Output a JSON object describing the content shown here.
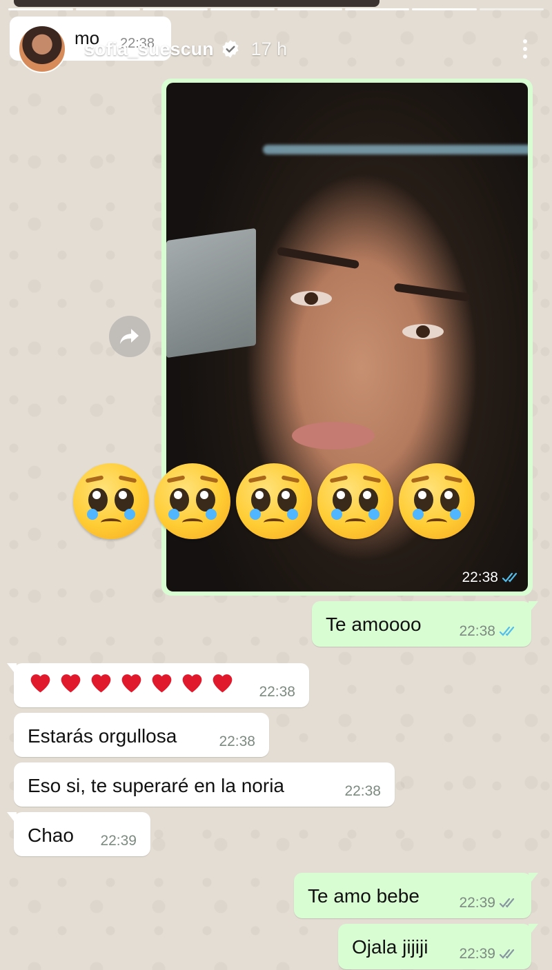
{
  "story": {
    "username": "sofia_suescun",
    "time_ago": "17 h",
    "progress_segments": 8,
    "progress_done": 7
  },
  "quoted": {
    "text": "mo",
    "time": "22:38"
  },
  "media_message": {
    "time": "22:38"
  },
  "emoji_row": {
    "emoji": "pleading-face",
    "count": 5
  },
  "messages": [
    {
      "text": "Te amoooo",
      "time": "22:38",
      "direction": "outgoing",
      "read": true
    },
    {
      "text": "",
      "time": "22:38",
      "direction": "incoming",
      "hearts": 7
    },
    {
      "text": "Estarás orgullosa",
      "time": "22:38",
      "direction": "incoming"
    },
    {
      "text": "Eso si, te superaré en la noria",
      "time": "22:38",
      "direction": "incoming"
    },
    {
      "text": "Chao",
      "time": "22:39",
      "direction": "incoming"
    },
    {
      "text": "Te amo bebe",
      "time": "22:39",
      "direction": "outgoing",
      "read": false
    },
    {
      "text": "Ojala jijiji",
      "time": "22:39",
      "direction": "outgoing",
      "read": false
    }
  ],
  "colors": {
    "outgoing_bubble": "#d9fdd3",
    "incoming_bubble": "#ffffff",
    "read_tick": "#53bdeb",
    "unread_tick": "#8696a0",
    "chat_background": "#e3ddd3"
  }
}
